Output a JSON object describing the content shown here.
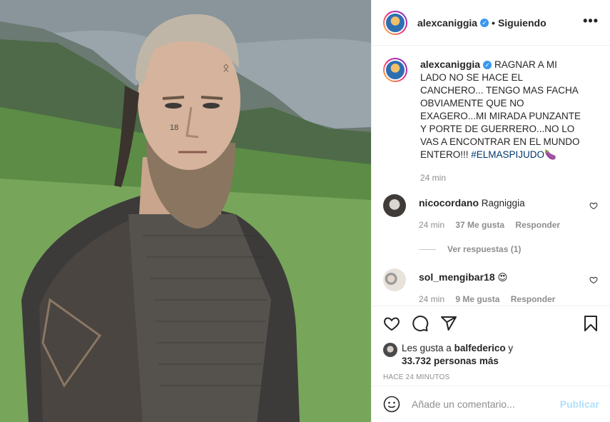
{
  "post": {
    "username": "alexcaniggia",
    "follow_separator": "•",
    "follow_status": "Siguiendo",
    "more_icon": "more-horizontal-icon"
  },
  "caption": {
    "username": "alexcaniggia",
    "text": "RAGNAR A MI LADO NO SE HACE EL CANCHERO... TENGO MAS FACHA OBVIAMENTE QUE NO EXAGERO...MI MIRADA PUNZANTE Y PORTE DE GUERRERO...NO LO VAS A ENCONTRAR EN EL MUNDO ENTERO!!! ",
    "hashtag": "#ELMASPIJUDO",
    "emoji": "🍆",
    "time": "24 min"
  },
  "comments": [
    {
      "username": "nicocordano",
      "text": "Ragniggia",
      "time": "24 min",
      "likes": "37 Me gusta",
      "reply": "Responder",
      "view_replies": "Ver respuestas (1)"
    },
    {
      "username": "sol_mengibar18",
      "text": "😍",
      "time": "24 min",
      "likes": "9 Me gusta",
      "reply": "Responder"
    }
  ],
  "likes": {
    "prefix": "Les gusta a",
    "user": "balfederico",
    "conj": "y",
    "others": "33.732 personas más"
  },
  "posted_ago": "HACE 24 MINUTOS",
  "add_comment": {
    "placeholder": "Añade un comentario...",
    "publish": "Publicar"
  },
  "colors": {
    "verified": "#3897f0",
    "publish_disabled": "#b2dffc",
    "hashtag": "#00376b",
    "meta": "#8e8e8e"
  }
}
